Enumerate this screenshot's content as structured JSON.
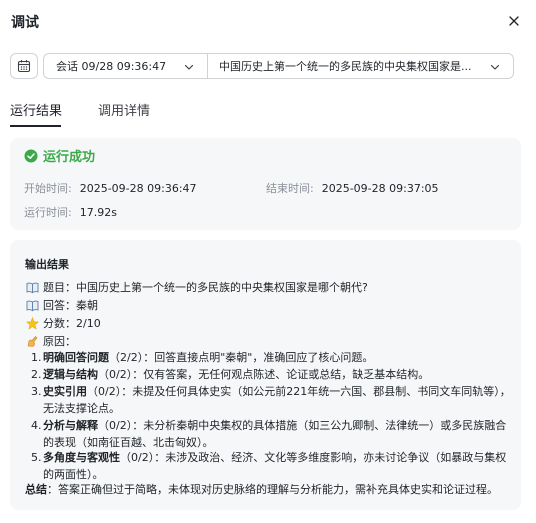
{
  "header": {
    "title": "调试"
  },
  "toolbar": {
    "session_label": "会话 09/28 09:36:47",
    "question_label": "中国历史上第一个统一的多民族的中央集权国家是..."
  },
  "tabs": [
    {
      "label": "运行结果",
      "active": true
    },
    {
      "label": "调用详情",
      "active": false
    }
  ],
  "status": {
    "text": "运行成功",
    "color": "#3ba94a",
    "start_label": "开始时间:",
    "start_value": "2025-09-28 09:36:47",
    "end_label": "结束时间:",
    "end_value": "2025-09-28 09:37:05",
    "duration_label": "运行时间:",
    "duration_value": "17.92s"
  },
  "output": {
    "title": "输出结果",
    "question": "题目：中国历史上第一个统一的多民族的中央集权国家是哪个朝代?",
    "answer": "回答：秦朝",
    "score": "分数：2/10",
    "reason": "原因：",
    "items": [
      {
        "num": "1.",
        "head": "明确回答问题",
        "text": "（2/2）：回答直接点明\"秦朝\"，准确回应了核心问题。"
      },
      {
        "num": "2.",
        "head": "逻辑与结构",
        "text": "（0/2）：仅有答案，无任何观点陈述、论证或总结，缺乏基本结构。"
      },
      {
        "num": "3.",
        "head": "史实引用",
        "text": "（0/2）：未提及任何具体史实（如公元前221年统一六国、郡县制、书同文车同轨等），无法支撑论点。"
      },
      {
        "num": "4.",
        "head": "分析与解释",
        "text": "（0/2）：未分析秦朝中央集权的具体措施（如三公九卿制、法律统一）或多民族融合的表现（如南征百越、北击匈奴）。"
      },
      {
        "num": "5.",
        "head": "多角度与客观性",
        "text": "（0/2）：未涉及政治、经济、文化等多维度影响，亦未讨论争议（如暴政与集权的两面性）。"
      }
    ],
    "summary_head": "总结",
    "summary_text": "：答案正确但过于简略，未体现对历史脉络的理解与分析能力，需补充具体史实和论证过程。"
  },
  "icons": {
    "close": "close-icon",
    "calendar": "calendar-icon",
    "chevron": "chevron-down-icon",
    "success": "check-circle-icon",
    "book": "book-icon",
    "star": "star-icon",
    "hand": "writing-hand-icon"
  }
}
